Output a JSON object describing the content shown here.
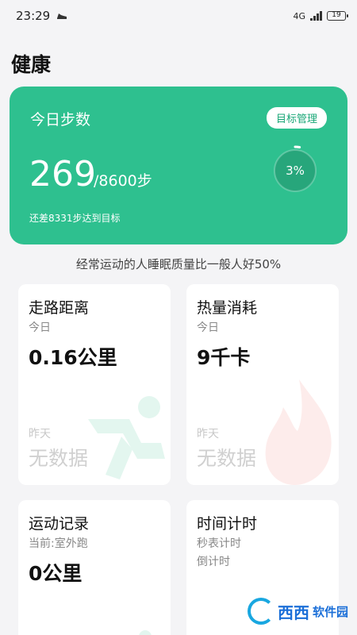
{
  "status_bar": {
    "time": "23:29",
    "network": "4G",
    "battery": "19",
    "notification_icon": "shoe-icon"
  },
  "page": {
    "title": "健康"
  },
  "steps_card": {
    "title": "今日步数",
    "goal_button": "目标管理",
    "steps": "269",
    "goal": "/8600步",
    "remaining": "还差8331步达到目标",
    "progress_label": "3%",
    "progress_fraction": 0.03,
    "background_color": "#2ec08f"
  },
  "tip": "经常运动的人睡眠质量比一般人好50%",
  "cards": {
    "walking": {
      "title": "走路距离",
      "today_label": "今日",
      "today_value": "0.16公里",
      "yesterday_label": "昨天",
      "yesterday_value": "无数据",
      "icon": "running-icon"
    },
    "calories": {
      "title": "热量消耗",
      "today_label": "今日",
      "today_value": "9千卡",
      "yesterday_label": "昨天",
      "yesterday_value": "无数据",
      "icon": "flame-icon"
    },
    "records": {
      "title": "运动记录",
      "current_label": "当前:室外跑",
      "value": "0公里"
    },
    "timer": {
      "title": "时间计时",
      "stopwatch": "秒表计时",
      "countdown": "倒计时"
    }
  },
  "watermark": {
    "text": "西西",
    "subtext": "软件园"
  }
}
